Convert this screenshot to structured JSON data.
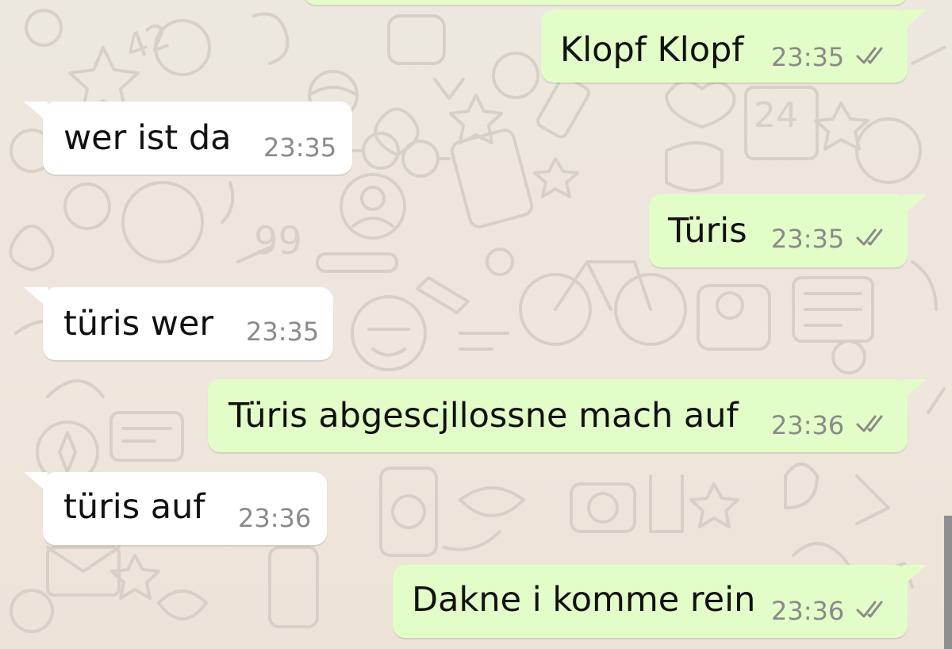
{
  "colors": {
    "incoming_bubble": "#ffffff",
    "outgoing_bubble": "#e3fdc8",
    "timestamp": "#8a8a8a",
    "read_ticks": "#8a8a8a",
    "wallpaper": "#ece7df"
  },
  "messages": [
    {
      "direction": "outgoing",
      "text": "Klopf Klopf",
      "time": "23:35",
      "status_icon": "double-check-icon"
    },
    {
      "direction": "incoming",
      "text": "wer ist da",
      "time": "23:35"
    },
    {
      "direction": "outgoing",
      "text": "Türis",
      "time": "23:35",
      "status_icon": "double-check-icon"
    },
    {
      "direction": "incoming",
      "text": "türis wer",
      "time": "23:35"
    },
    {
      "direction": "outgoing",
      "text": "Türis abgescjllossne mach auf",
      "time": "23:36",
      "status_icon": "double-check-icon"
    },
    {
      "direction": "incoming",
      "text": "türis auf",
      "time": "23:36"
    },
    {
      "direction": "outgoing",
      "text": "Dakne i komme rein",
      "time": "23:36",
      "status_icon": "double-check-icon"
    }
  ]
}
